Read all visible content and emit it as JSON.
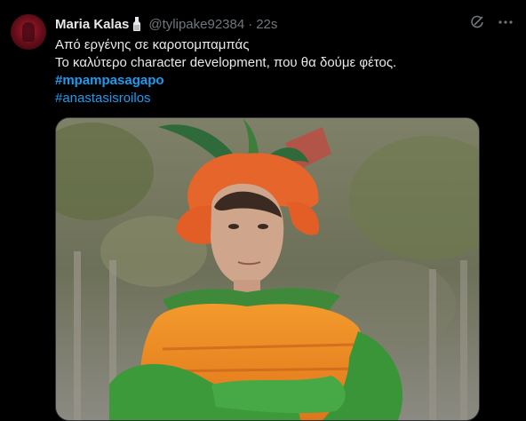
{
  "tweet": {
    "author_name": "Maria Kalas",
    "handle": "@tylipake92384",
    "separator": "·",
    "time": "22s",
    "lines": [
      "Από εργένης σε καροτομπαμπάς",
      "Το καλύτερο character development, που θα δούμε φέτος."
    ],
    "hashtags": [
      "#mpampasagapo",
      "#anastasisroilos"
    ]
  },
  "icons": {
    "avatar": "avatar-image",
    "badge": "milk-bottle-icon",
    "grok": "grok-icon",
    "more": "more-icon"
  },
  "colors": {
    "background": "#000000",
    "text": "#e7e9ea",
    "muted": "#71767b",
    "link": "#1d9bf0"
  },
  "media": {
    "kind": "photo",
    "subject": "man in orange carrot costume with green leafy hat, arms crossed"
  }
}
